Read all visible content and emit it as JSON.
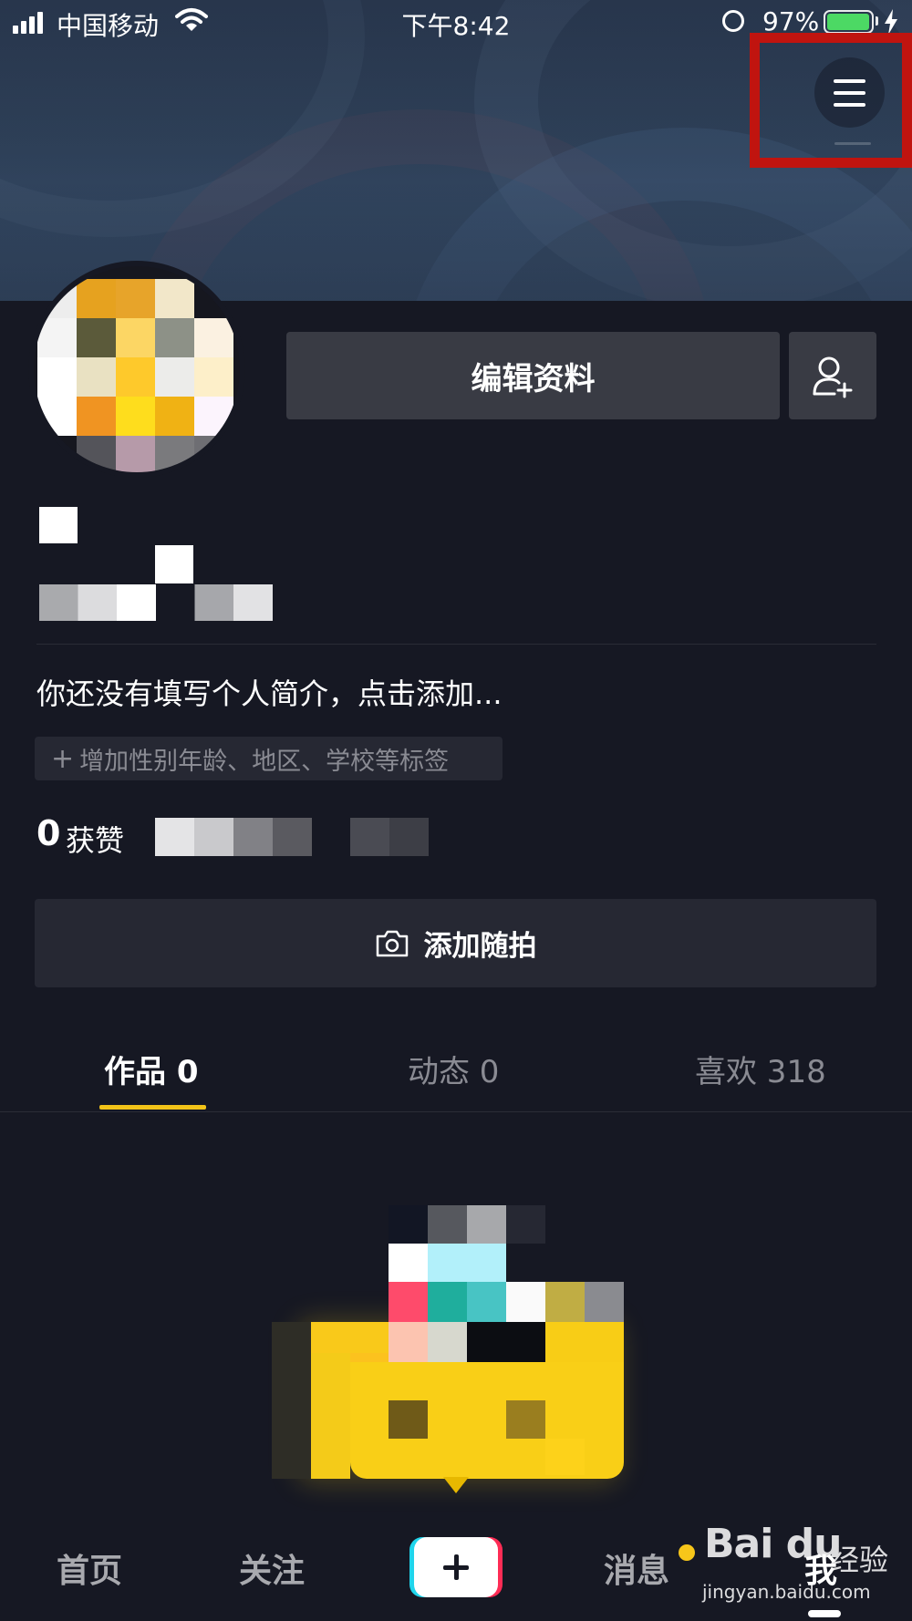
{
  "status_bar": {
    "carrier": "中国移动",
    "time": "下午8:42",
    "battery": "97%",
    "battery_level": 0.97
  },
  "profile": {
    "edit_button_label": "编辑资料",
    "bio_placeholder": "你还没有填写个人简介，点击添加...",
    "tag_prompt": "增加性别年龄、地区、学校等标签",
    "likes_count": "0",
    "likes_label": "获赞",
    "add_moment_label": "添加随拍"
  },
  "tabs": [
    {
      "label": "作品 0",
      "active": true
    },
    {
      "label": "动态 0",
      "active": false
    },
    {
      "label": "喜欢 318",
      "active": false
    }
  ],
  "bottom_nav": {
    "home": "首页",
    "follow": "关注",
    "messages": "消息",
    "me": "我"
  },
  "watermark": {
    "logo": "Bai du",
    "experience": "经验",
    "url": "jingyan.baidu.com"
  },
  "colors": {
    "background": "#161823",
    "accent_yellow": "#f2c318",
    "highlight_red": "#c0140f",
    "button_gray": "#393b44"
  },
  "icons": [
    "signal-icon",
    "wifi-icon",
    "rotation-lock-icon",
    "battery-icon",
    "charging-icon",
    "menu-icon",
    "add-friend-icon",
    "camera-icon",
    "plus-icon"
  ]
}
